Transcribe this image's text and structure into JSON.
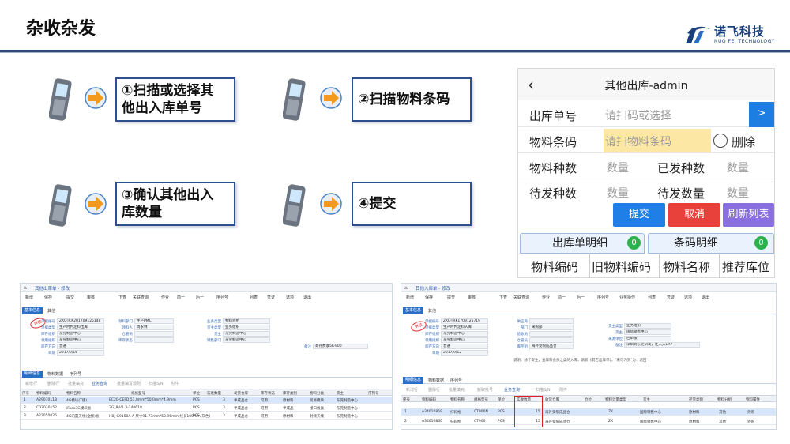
{
  "slide": {
    "title": "杂收杂发",
    "logo": {
      "cn": "诺飞科技",
      "en": "NUO FEI TECHNOLOGY"
    }
  },
  "steps": [
    {
      "number": "①",
      "text": "扫描或选择其他出入库单号"
    },
    {
      "number": "②",
      "text": "扫描物料条码"
    },
    {
      "number": "③",
      "text": "确认其他出入库数量"
    },
    {
      "number": "④",
      "text": "提交"
    }
  ],
  "step_lines": {
    "s1a": "①扫描或选择其",
    "s1b": "他出入库单号",
    "s2": "②扫描物料条码",
    "s3a": "③确认其他出入",
    "s3b": "库数量",
    "s4": "④提交"
  },
  "phone": {
    "back_icon": "chevron-left-icon",
    "title": "其他出库-admin",
    "order_label": "出库单号",
    "order_placeholder": "请扫码或选择",
    "go_label": ">",
    "barcode_label": "物料条码",
    "barcode_placeholder": "请扫物料条码",
    "delete_label": "删除",
    "kinds_label": "物料种数",
    "kinds_value": "数量",
    "sent_kinds_label": "已发种数",
    "sent_kinds_value": "数量",
    "pending_kinds_label": "待发种数",
    "pending_kinds_value": "数量",
    "pending_qty_label": "待发数量",
    "pending_qty_value": "数量",
    "submit": "提交",
    "cancel": "取消",
    "refresh": "刷新列表",
    "tab_detail": "出库单明细",
    "tab_detail_count": "0",
    "tab_barcode": "条码明细",
    "tab_barcode_count": "0",
    "columns": [
      "物料编码",
      "旧物料编码",
      "物料名称",
      "推荐库位"
    ],
    "colors": {
      "go": "#1e7de0",
      "submit": "#1f7fe6",
      "cancel": "#e8413c",
      "refresh": "#8a6fe0"
    }
  },
  "erp_left": {
    "tab": "其他出库单 - 修改",
    "toolbar": [
      "新增",
      "保存",
      "提交",
      "审核",
      "下查",
      "关联查询",
      "作业",
      "前一",
      "后一",
      "序列号",
      "列表",
      "凭证",
      "选项",
      "退出"
    ],
    "section_tabs": [
      "基本信息",
      "其他"
    ],
    "stamp": "审核",
    "fields": [
      {
        "label": "单据编号",
        "value": "ZKQTCK201709125148"
      },
      {
        "label": "单据类型",
        "value": "生产时判定料出库"
      },
      {
        "label": "库存组织",
        "value": "东莞制造中心"
      },
      {
        "label": "领用组织",
        "value": "东莞制造中心"
      },
      {
        "label": "库存方向",
        "value": "普通"
      },
      {
        "label": "日期",
        "value": "2017/9/16"
      },
      {
        "label": "领料部门",
        "value": "生产PMC"
      },
      {
        "label": "领料人",
        "value": "周永林"
      },
      {
        "label": "仓管员",
        "value": ""
      },
      {
        "label": "库存状态",
        "value": ""
      },
      {
        "label": "业务类型",
        "value": "物料领用"
      },
      {
        "label": "货主类型",
        "value": "业务组织"
      },
      {
        "label": "货主",
        "value": "东莞制造中心"
      },
      {
        "label": "销售部门",
        "value": "东莞制造中心"
      },
      {
        "label": "备注",
        "value": "寄存费收5K-900"
      }
    ],
    "detail_tabs": [
      "明细信息",
      "物料数据",
      "序列号"
    ],
    "grid_toolbar": [
      "新增行",
      "删除行",
      "批量填充",
      "业务查询",
      "批量填写规则",
      "扫描S/N",
      "附件"
    ],
    "columns": [
      "序号",
      "物料编码",
      "物料名称",
      "规格型号",
      "单位",
      "实发数量",
      "发货仓库",
      "库存状态",
      "库存类别",
      "物料分类",
      "货主",
      "序列号"
    ],
    "rows": [
      [
        "1",
        "A29070118",
        "4G模块(T版)",
        "EC20-CEFD 51.0mm*50.0mm*4.9mm",
        "PCS",
        "3",
        "半成品仓",
        "可用",
        "原材料",
        "贸易模块",
        "东莞制造中心"
      ],
      [
        "2",
        "C02030152",
        "iFace3G模块板",
        "3G_8-V1.3-140618",
        "PCS",
        "3",
        "半成品仓",
        "可用",
        "半成品",
        "接口板类",
        "东莞制造中心"
      ],
      [
        "3",
        "A22050026",
        "4G内置天线(全频)板",
        "HBJ-G9150A-A 尺寸91.73mm*50.96mm 线长100mm(灰色)",
        "PCS",
        "3",
        "半成品仓",
        "可用",
        "原材料",
        "射频天线",
        "东莞制造中心"
      ]
    ]
  },
  "erp_right": {
    "tab": "其他入库单 - 修改",
    "toolbar": [
      "新增",
      "保存",
      "提交",
      "审核",
      "下查",
      "关联查询",
      "作业",
      "前一",
      "后一",
      "序列号",
      "业务操作",
      "列表",
      "凭证",
      "选项",
      "退出"
    ],
    "section_tabs": [
      "基本信息",
      "其他"
    ],
    "stamp": "审核",
    "fields": [
      {
        "label": "单据编号",
        "value": "ZKQTRK1709125719"
      },
      {
        "label": "单据类型",
        "value": "生产时判定料入库"
      },
      {
        "label": "库存组织",
        "value": "东莞制造中心"
      },
      {
        "label": "领用组织",
        "value": "东莞制造中心"
      },
      {
        "label": "库存方向",
        "value": "普通"
      },
      {
        "label": "日期",
        "value": "2017/9/12"
      },
      {
        "label": "供应商",
        "value": ""
      },
      {
        "label": "部门",
        "value": "采购部"
      },
      {
        "label": "验收员",
        "value": ""
      },
      {
        "label": "仓管员",
        "value": ""
      },
      {
        "label": "库存组",
        "value": "海外受限成品仓"
      },
      {
        "label": "货主类型",
        "value": "业务组织"
      },
      {
        "label": "货主",
        "value": "国际销售中心"
      },
      {
        "label": "来源单位",
        "value": "已审核"
      },
      {
        "label": "备注",
        "value": "深圳到东莞研发，还未入ERP"
      }
    ],
    "note": "说明：除了寄生，查库料会员之类的入库，请新《其它出库单》，\"来可为到\"为：退回",
    "detail_tabs": [
      "明细信息",
      "物料数据",
      "序列号"
    ],
    "grid_toolbar": [
      "新增行",
      "删除行",
      "批量填充",
      "获取批号",
      "业务查询",
      "扫描S/N",
      "附件"
    ],
    "columns": [
      "序号",
      "物料编码",
      "物料名称",
      "规格型号",
      "单位",
      "实收数量",
      "收货仓库",
      "仓位",
      "物料计量类型",
      "货主",
      "存货类别",
      "物料分组",
      "物料属性"
    ],
    "rows": [
      [
        "1",
        "A34010859",
        "扫码枪",
        "CT900N",
        "PCS",
        "15",
        "海外受限成品仓",
        "",
        "ZK",
        "国际销售中心",
        "原材料",
        "其他",
        "外购"
      ],
      [
        "2",
        "A34010860",
        "扫码枪",
        "CT900",
        "PCS",
        "15",
        "海外受限成品仓",
        "",
        "ZK",
        "国际销售中心",
        "原材料",
        "其他",
        "外购"
      ]
    ]
  }
}
